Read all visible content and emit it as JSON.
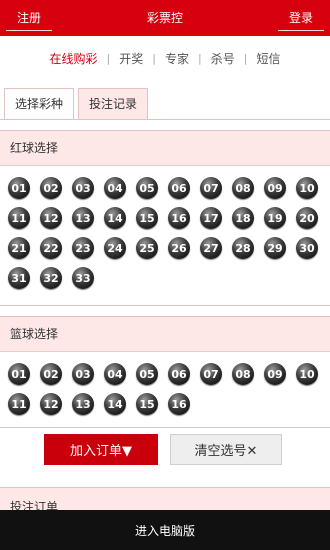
{
  "header": {
    "left_button": "注册",
    "title": "彩票控",
    "right_button": "登录"
  },
  "subnav": [
    "在线购彩",
    "开奖",
    "专家",
    "杀号",
    "短信"
  ],
  "tabs": [
    "选择彩种",
    "投注记录"
  ],
  "red_section": {
    "title": "红球选择",
    "balls": [
      "01",
      "02",
      "03",
      "04",
      "05",
      "06",
      "07",
      "08",
      "09",
      "10",
      "11",
      "12",
      "13",
      "14",
      "15",
      "16",
      "17",
      "18",
      "19",
      "20",
      "21",
      "22",
      "23",
      "24",
      "25",
      "26",
      "27",
      "28",
      "29",
      "30",
      "31",
      "32",
      "33"
    ]
  },
  "blue_section": {
    "title": "篮球选择",
    "balls": [
      "01",
      "02",
      "03",
      "04",
      "05",
      "06",
      "07",
      "08",
      "09",
      "10",
      "11",
      "12",
      "13",
      "14",
      "15",
      "16"
    ]
  },
  "actions": {
    "add_label": "加入订单▼",
    "clear_label": "清空选号✕"
  },
  "order": {
    "title": "投注订单"
  },
  "footer": {
    "label": "进入电脑版"
  },
  "colors": {
    "brand_red": "#d7000f",
    "tab_bg": "#fde7e7"
  }
}
